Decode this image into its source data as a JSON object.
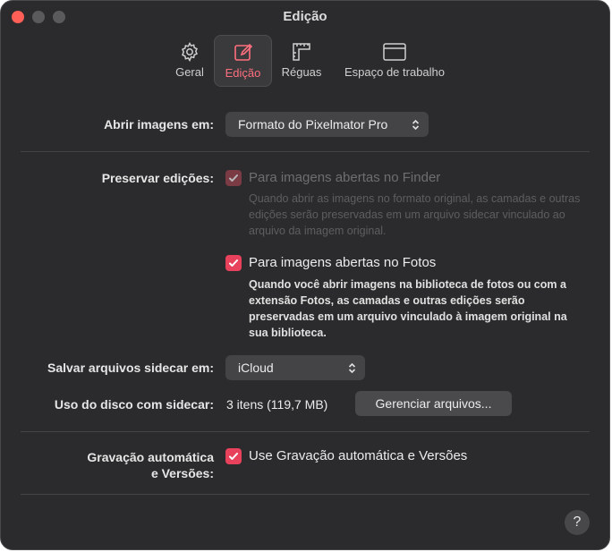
{
  "window": {
    "title": "Edição"
  },
  "toolbar": {
    "tabs": [
      {
        "label": "Geral",
        "icon": "gear-icon"
      },
      {
        "label": "Edição",
        "icon": "edit-icon",
        "active": true
      },
      {
        "label": "Réguas",
        "icon": "ruler-icon"
      },
      {
        "label": "Espaço de trabalho",
        "icon": "window-icon"
      }
    ]
  },
  "open_images": {
    "label": "Abrir imagens em:",
    "value": "Formato do Pixelmator Pro"
  },
  "preserve": {
    "label": "Preservar edições:",
    "finder": {
      "label": "Para imagens abertas no Finder",
      "checked": true,
      "enabled": false,
      "description": "Quando abrir as imagens no formato original, as camadas e outras edições serão preservadas em um arquivo sidecar vinculado ao arquivo da imagem original."
    },
    "photos": {
      "label": "Para imagens abertas no Fotos",
      "checked": true,
      "enabled": true,
      "description": "Quando você abrir imagens na biblioteca de fotos ou com a extensão Fotos, as camadas e outras edições serão preservadas em um arquivo vinculado à imagem original na sua biblioteca."
    }
  },
  "sidecar": {
    "label": "Salvar arquivos sidecar em:",
    "value": "iCloud"
  },
  "disk": {
    "label": "Uso do disco com sidecar:",
    "value": "3 itens (119,7 MB)",
    "button": "Gerenciar arquivos..."
  },
  "autosave": {
    "label_line1": "Gravação automática",
    "label_line2": "e Versões:",
    "option": "Use Gravação automática e Versões",
    "checked": true
  },
  "help": {
    "label": "?"
  },
  "colors": {
    "accent": "#e8415b",
    "window_bg": "#2b2b2d",
    "active_tab_text": "#ff6f7d"
  }
}
